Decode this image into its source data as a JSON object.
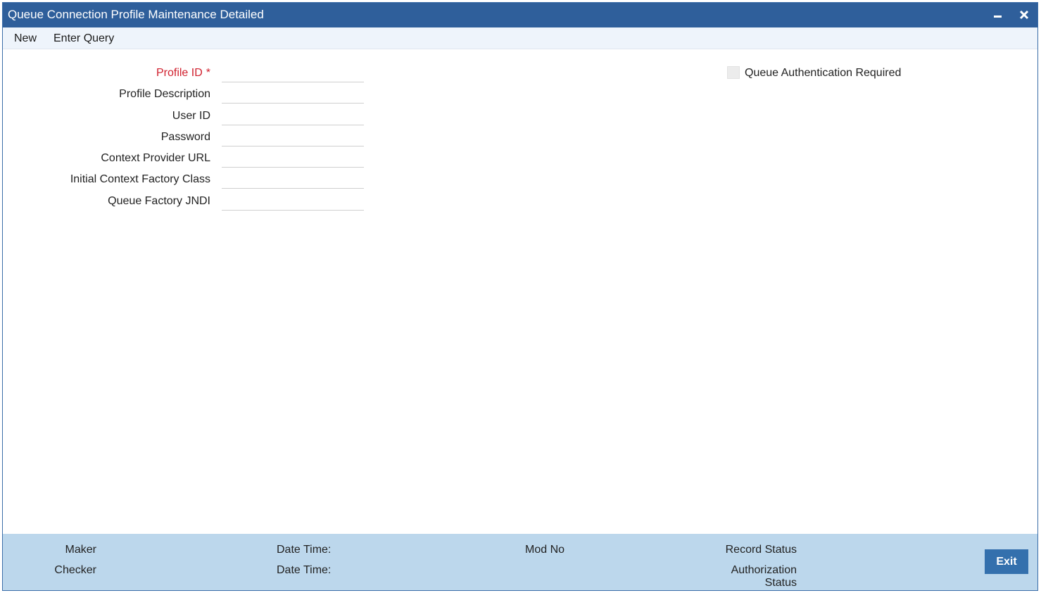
{
  "window": {
    "title": "Queue Connection Profile Maintenance Detailed"
  },
  "menu": {
    "items": [
      {
        "label": "New"
      },
      {
        "label": "Enter Query"
      }
    ]
  },
  "form": {
    "fields": [
      {
        "label": "Profile ID",
        "value": "",
        "required": true
      },
      {
        "label": "Profile Description",
        "value": ""
      },
      {
        "label": "User ID",
        "value": ""
      },
      {
        "label": "Password",
        "value": ""
      },
      {
        "label": "Context Provider URL",
        "value": ""
      },
      {
        "label": "Initial Context Factory Class",
        "value": ""
      },
      {
        "label": "Queue Factory JNDI",
        "value": ""
      }
    ],
    "required_marker": "*",
    "checkbox": {
      "label": "Queue Authentication Required",
      "checked": false
    }
  },
  "footer": {
    "maker_label": "Maker",
    "checker_label": "Checker",
    "maker_datetime_label": "Date Time:",
    "checker_datetime_label": "Date Time:",
    "mod_no_label": "Mod No",
    "record_status_label": "Record Status",
    "authorization_status_label_line1": "Authorization",
    "authorization_status_label_line2": "Status",
    "exit_label": "Exit"
  },
  "colors": {
    "titlebar": "#2f5f9b",
    "menubar": "#eef4fb",
    "footer": "#bcd7ec",
    "required_label": "#d0202e",
    "exit_button": "#3470ad"
  },
  "icons": {
    "minimize": "minimize-icon",
    "close": "close-icon"
  }
}
